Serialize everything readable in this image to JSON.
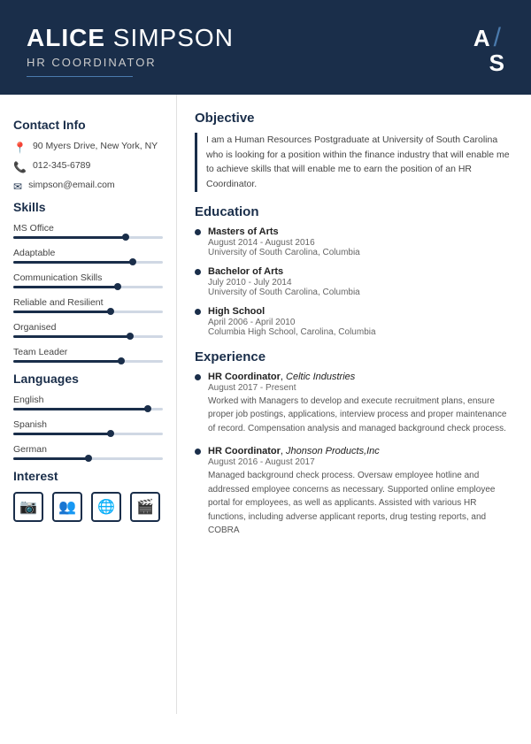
{
  "header": {
    "first_name": "ALICE",
    "last_name": "SIMPSON",
    "title": "HR COORDINATOR",
    "monogram_first": "A",
    "monogram_second": "S"
  },
  "contact": {
    "section_title": "Contact Info",
    "address": "90 Myers Drive, New York, NY",
    "phone": "012-345-6789",
    "email": "simpson@email.com"
  },
  "skills": {
    "section_title": "Skills",
    "items": [
      {
        "label": "MS Office",
        "value": 75
      },
      {
        "label": "Adaptable",
        "value": 80
      },
      {
        "label": "Communication Skills",
        "value": 70
      },
      {
        "label": "Reliable and Resilient",
        "value": 65
      },
      {
        "label": "Organised",
        "value": 78
      },
      {
        "label": "Team Leader",
        "value": 72
      }
    ]
  },
  "languages": {
    "section_title": "Languages",
    "items": [
      {
        "label": "English",
        "value": 90
      },
      {
        "label": "Spanish",
        "value": 65
      },
      {
        "label": "German",
        "value": 50
      }
    ]
  },
  "interests": {
    "section_title": "Interest",
    "items": [
      "📷",
      "👥",
      "🌐",
      "🎬"
    ]
  },
  "objective": {
    "section_title": "Objective",
    "text": "I am a Human Resources Postgraduate at University of South Carolina who is looking for a position within the finance industry that will enable me to achieve skills that will enable me to earn the position of an HR Coordinator."
  },
  "education": {
    "section_title": "Education",
    "items": [
      {
        "degree": "Masters of Arts",
        "date": "August 2014 - August 2016",
        "institution": "University of South Carolina, Columbia"
      },
      {
        "degree": "Bachelor of Arts",
        "date": "July 2010 - July 2014",
        "institution": "University of South Carolina, Columbia"
      },
      {
        "degree": "High School",
        "date": "April 2006 - April 2010",
        "institution": "Columbia High School, Carolina, Columbia"
      }
    ]
  },
  "experience": {
    "section_title": "Experience",
    "items": [
      {
        "role": "HR Coordinator",
        "company": "Celtic Industries",
        "date": "August 2017 - Present",
        "description": "Worked with Managers to develop and execute recruitment plans, ensure proper job postings, applications, interview process and proper maintenance of record. Compensation analysis and managed background check process."
      },
      {
        "role": "HR Coordinator",
        "company": "Jhonson Products,Inc",
        "date": "August 2016 - August 2017",
        "description": "Managed background check process. Oversaw employee hotline and addressed employee concerns as necessary. Supported online employee portal for employees, as well as applicants. Assisted with various HR functions, including adverse applicant reports, drug testing reports, and COBRA"
      }
    ]
  }
}
